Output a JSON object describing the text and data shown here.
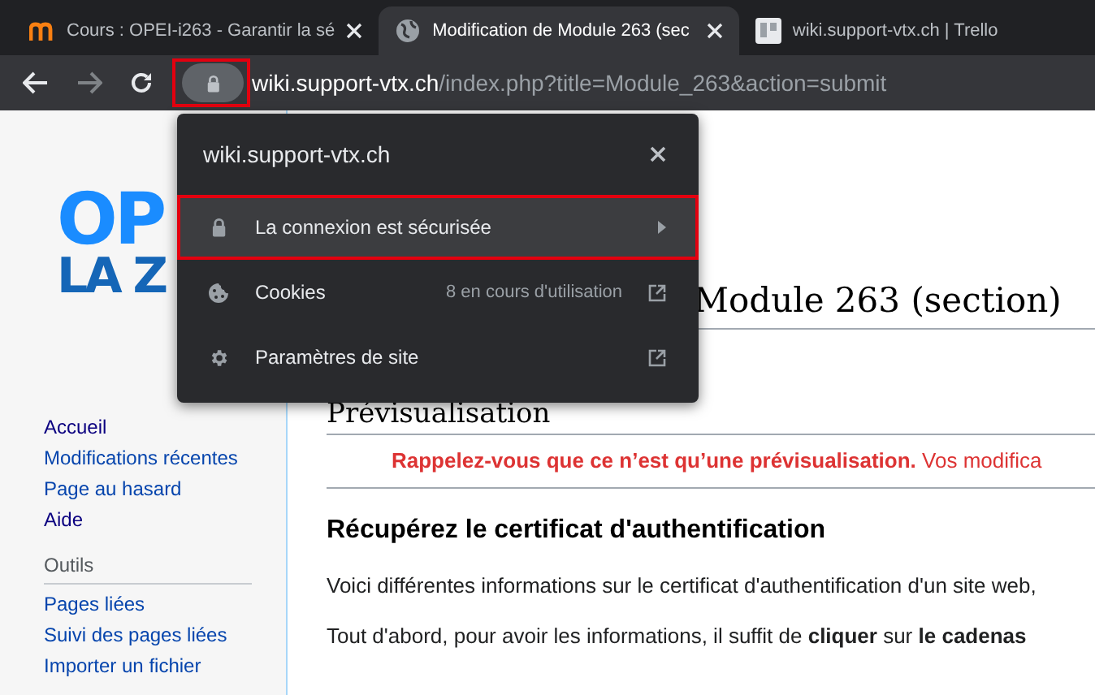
{
  "tabs": [
    {
      "title": "Cours : OPEI-i263 - Garantir la sé",
      "selected": false,
      "closable": true
    },
    {
      "title": "Modification de Module 263 (sec",
      "selected": true,
      "closable": true
    },
    {
      "title": "wiki.support-vtx.ch | Trello",
      "selected": false,
      "closable": false
    }
  ],
  "address_bar": {
    "host": "wiki.support-vtx.ch",
    "path": "/index.php?title=Module_263&action=submit",
    "lock_highlighted": true
  },
  "site_popup": {
    "title": "wiki.support-vtx.ch",
    "items": [
      {
        "kind": "submenu",
        "label": "La connexion est sécurisée",
        "highlighted": true
      },
      {
        "kind": "external",
        "label": "Cookies",
        "detail": "8 en cours d'utilisation",
        "highlighted": false
      },
      {
        "kind": "external",
        "label": "Paramètres de site",
        "highlighted": false
      }
    ]
  },
  "logo": {
    "line_1": "OP",
    "line_2": "LA Z"
  },
  "sidebar": {
    "navigation": [
      {
        "label": "Accueil",
        "visited": true
      },
      {
        "label": "Modifications récentes",
        "visited": false
      },
      {
        "label": "Page au hasard",
        "visited": false
      },
      {
        "label": "Aide",
        "visited": true
      }
    ],
    "tools_title": "Outils",
    "tools": [
      {
        "label": "Pages liées",
        "visited": false
      },
      {
        "label": "Suivi des pages liées",
        "visited": false
      },
      {
        "label": "Importer un fichier",
        "visited": false
      }
    ]
  },
  "content": {
    "page_title": "Module 263 (section)",
    "preview_heading": "Prévisualisation",
    "preview_warning": "Rappelez-vous que ce n’est qu’une prévisualisation.",
    "preview_warning_rest": "Vos modifica",
    "section_heading": "Récupérez le certificat d'authentification",
    "paragraphs": [
      "Voici différentes informations sur le certificat d'authentification d'un site web,",
      "Tout d'abord, pour avoir les informations, il suffit de **cliquer** sur **le cadenas**"
    ]
  }
}
